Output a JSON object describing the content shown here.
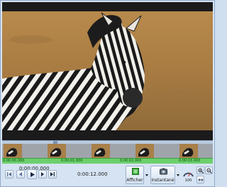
{
  "playback": {
    "current_time": "0:00:00.000",
    "position_time": "0:00:00.000",
    "duration": "0:00:12.000",
    "progress": 0.25
  },
  "timeline": {
    "labels": [
      "0:00:00.000",
      "0:00:01.000",
      "0:00:02.000",
      "0:00:03.000"
    ],
    "thumbnail_count": 5
  },
  "toolbar": {
    "afficher_label": "Afficher",
    "instantane_label": "Instantané",
    "speed_label": "100"
  },
  "colors": {
    "ruler_green": "#6cd06c",
    "panel_blue": "#d6e3f2",
    "video_black": "#111111"
  },
  "icons": {
    "first_frame": "skip-to-start-icon",
    "prev_frame": "step-back-icon",
    "play": "play-icon",
    "next_frame": "step-forward-icon",
    "last_frame": "skip-to-end-icon",
    "afficher": "green-view-icon",
    "instantane": "camera-icon",
    "speed": "speedometer-icon",
    "zoom_in": "zoom-in-icon",
    "zoom_out": "zoom-out-icon",
    "fit": "fit-width-icon"
  }
}
